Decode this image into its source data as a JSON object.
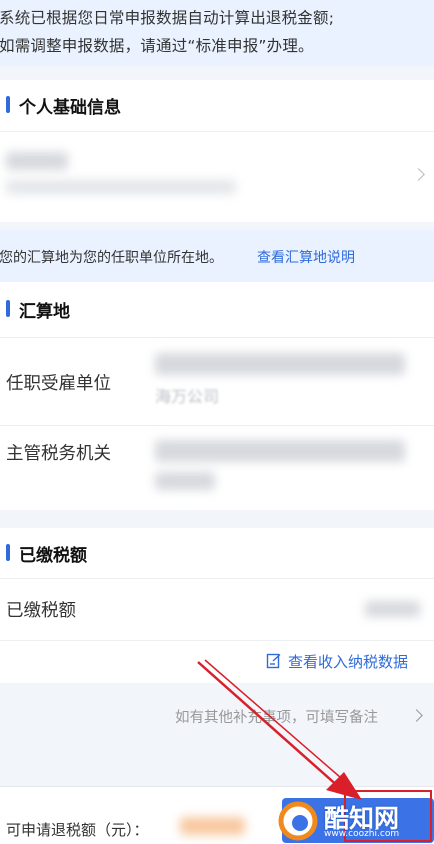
{
  "notice": {
    "line1": "系统已根据您日常申报数据自动计算出退税金额;",
    "line2": "如需调整申报数据，请通过“标准申报”办理。"
  },
  "personal_info": {
    "title": "个人基础信息"
  },
  "location_info": {
    "text": "您的汇算地为您的任职单位所在地。",
    "link": "查看汇算地说明"
  },
  "settlement": {
    "title": "汇算地",
    "employer_label": "任职受雇单位",
    "employer_value_partial": "海万公司",
    "tax_office_label": "主管税务机关"
  },
  "paid_tax": {
    "title": "已缴税额",
    "row_label": "已缴税额",
    "view_link": "查看收入纳税数据"
  },
  "remark": {
    "text": "如有其他补充事项，可填写备注"
  },
  "bottom": {
    "refund_label": "可申请退税额（元）："
  },
  "watermark": {
    "brand": "酷知网",
    "url": "www.coozhi.com"
  },
  "colors": {
    "accent": "#2f6bdb",
    "notice_bg": "#eaf2ff",
    "arrow_red": "#d9202a"
  }
}
